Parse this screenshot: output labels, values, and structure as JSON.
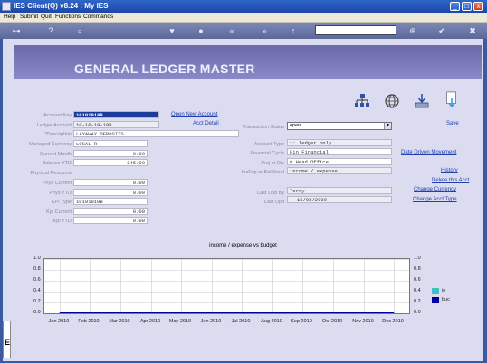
{
  "window": {
    "title": "IES Client(Q) v8.24 : My IES",
    "buttons": {
      "minimize": "_",
      "maximize": "□",
      "close": "x"
    }
  },
  "menu": [
    "Help",
    "Submit",
    "Quit",
    "Functions",
    "Commands"
  ],
  "header": {
    "title": "GENERAL LEDGER MASTER"
  },
  "left_form": {
    "account_key": {
      "label": "Account Key",
      "value": "10101010B"
    },
    "ledger_account": {
      "label": "Ledger Account",
      "value": "10-10-10-10B"
    },
    "description": {
      "label": "*Description",
      "value": "LAYAWAY DEPOSITS"
    },
    "managed_currency": {
      "label": "Managed Currency",
      "value": "LOCAL R"
    },
    "current_month": {
      "label": "Current Month",
      "value": "0.00"
    },
    "balance_ytd": {
      "label": "Balance YTD",
      "value": "-245.00"
    },
    "physical_resource": {
      "label": "Physical Resource",
      "value": ""
    },
    "phys_current": {
      "label": "Phys Current",
      "value": "0.00"
    },
    "phys_ytd": {
      "label": "Phys YTD",
      "value": "0.00"
    },
    "kpi_type": {
      "label": "KPI Type",
      "value": "10101010B"
    },
    "kpi_current": {
      "label": "Kpi Current",
      "value": "0.00"
    },
    "kpi_ytd": {
      "label": "Kpi YTD",
      "value": "0.00"
    }
  },
  "mid_links": {
    "open_new_account": "Open New Account",
    "acct_detail": "Acct Detail"
  },
  "right_form": {
    "transaction_status": {
      "label": "Transaction Status",
      "value": "open"
    },
    "account_type": {
      "label": "Account Type",
      "value": "1: ledger only"
    },
    "financial_cycle": {
      "label": "Financial Cycle",
      "value": "Fin Financial"
    },
    "proj_or_div": {
      "label": "Proj or Div",
      "value": "0 Head Office"
    },
    "incexp_balsheet": {
      "label": "IncExp or BalSheet",
      "value": "income / expense"
    },
    "last_upd_by": {
      "label": "Last Upd By",
      "value": "Terry"
    },
    "last_upd": {
      "label": "Last Upd",
      "value": "15/08/2009"
    }
  },
  "right_links": {
    "save": "Save",
    "date_driven_movement": "Date Driven Movement",
    "history": "History",
    "delete_this_acct": "Delete this Acct",
    "change_currency": "Change Currency",
    "change_acct_type": "Change Acct Type"
  },
  "icons": [
    "network-icon",
    "globe-icon",
    "download-tray-icon",
    "document-arrow-icon"
  ],
  "colors": {
    "accent": "#2040b0",
    "header_band": "#7a7ab8",
    "legend_ie": "#40c0c0",
    "legend_buc": "#0000a0"
  },
  "chart_data": {
    "type": "line",
    "title": "income / expense vs budget",
    "categories": [
      "Jan 2010",
      "Feb 2010",
      "Mar 2010",
      "Apr 2010",
      "May 2010",
      "Jun 2010",
      "Jul 2010",
      "Aug 2010",
      "Sep 2010",
      "Oct 2010",
      "Nov 2010",
      "Dec 2010"
    ],
    "ylim": [
      0.0,
      1.0
    ],
    "yticks": [
      "1.0",
      "0.8",
      "0.6",
      "0.4",
      "0.2",
      "0.0"
    ],
    "grid": true,
    "legend_placement": "right",
    "series": [
      {
        "name": "ie",
        "values": [
          0,
          0,
          0,
          0,
          0,
          0,
          0,
          0,
          0,
          0,
          0,
          0
        ]
      },
      {
        "name": "buc",
        "values": [
          0,
          0,
          0,
          0,
          0,
          0,
          0,
          0,
          0,
          0,
          0,
          0
        ]
      }
    ]
  },
  "left_stub_letter": "E"
}
